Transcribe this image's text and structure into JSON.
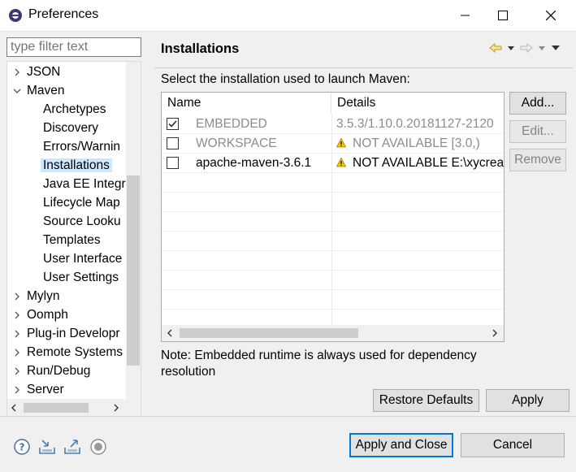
{
  "window": {
    "title": "Preferences",
    "icon": "eclipse-icon"
  },
  "filter": {
    "placeholder": "type filter text"
  },
  "tree": [
    {
      "label": "JSON",
      "level": 0,
      "arrow": "right"
    },
    {
      "label": "Maven",
      "level": 0,
      "arrow": "down"
    },
    {
      "label": "Archetypes",
      "level": 1
    },
    {
      "label": "Discovery",
      "level": 1
    },
    {
      "label": "Errors/Warnin",
      "level": 1
    },
    {
      "label": "Installations",
      "level": 1,
      "selected": true
    },
    {
      "label": "Java EE Integra",
      "level": 1
    },
    {
      "label": "Lifecycle Map",
      "level": 1
    },
    {
      "label": "Source Looku",
      "level": 1
    },
    {
      "label": "Templates",
      "level": 1
    },
    {
      "label": "User Interface",
      "level": 1
    },
    {
      "label": "User Settings",
      "level": 1
    },
    {
      "label": "Mylyn",
      "level": 0,
      "arrow": "right"
    },
    {
      "label": "Oomph",
      "level": 0,
      "arrow": "right"
    },
    {
      "label": "Plug-in Developr",
      "level": 0,
      "arrow": "right"
    },
    {
      "label": "Remote Systems",
      "level": 0,
      "arrow": "right"
    },
    {
      "label": "Run/Debug",
      "level": 0,
      "arrow": "right"
    },
    {
      "label": "Server",
      "level": 0,
      "arrow": "right"
    }
  ],
  "page": {
    "title": "Installations",
    "description": "Select the installation used to launch Maven:",
    "note": "Note: Embedded runtime is always used for dependency resolution"
  },
  "table": {
    "headers": {
      "name": "Name",
      "details": "Details"
    },
    "rows": [
      {
        "checked": true,
        "name": "EMBEDDED",
        "details": "3.5.3/1.10.0.20181127-2120",
        "disabled": true,
        "warning": false
      },
      {
        "checked": false,
        "name": "WORKSPACE",
        "details": "NOT AVAILABLE [3.0,)",
        "disabled": true,
        "warning": true
      },
      {
        "checked": false,
        "name": "apache-maven-3.6.1",
        "details": "NOT AVAILABLE E:\\xycrea",
        "disabled": false,
        "warning": true
      }
    ]
  },
  "buttons": {
    "add": "Add...",
    "edit": "Edit...",
    "remove": "Remove",
    "restore_defaults": "Restore Defaults",
    "apply": "Apply",
    "apply_close": "Apply and Close",
    "cancel": "Cancel"
  },
  "colors": {
    "selection": "#cce8ff",
    "disabled_text": "#8c8c8c",
    "warning": "#f5c400",
    "focus_border": "#0078d7"
  }
}
